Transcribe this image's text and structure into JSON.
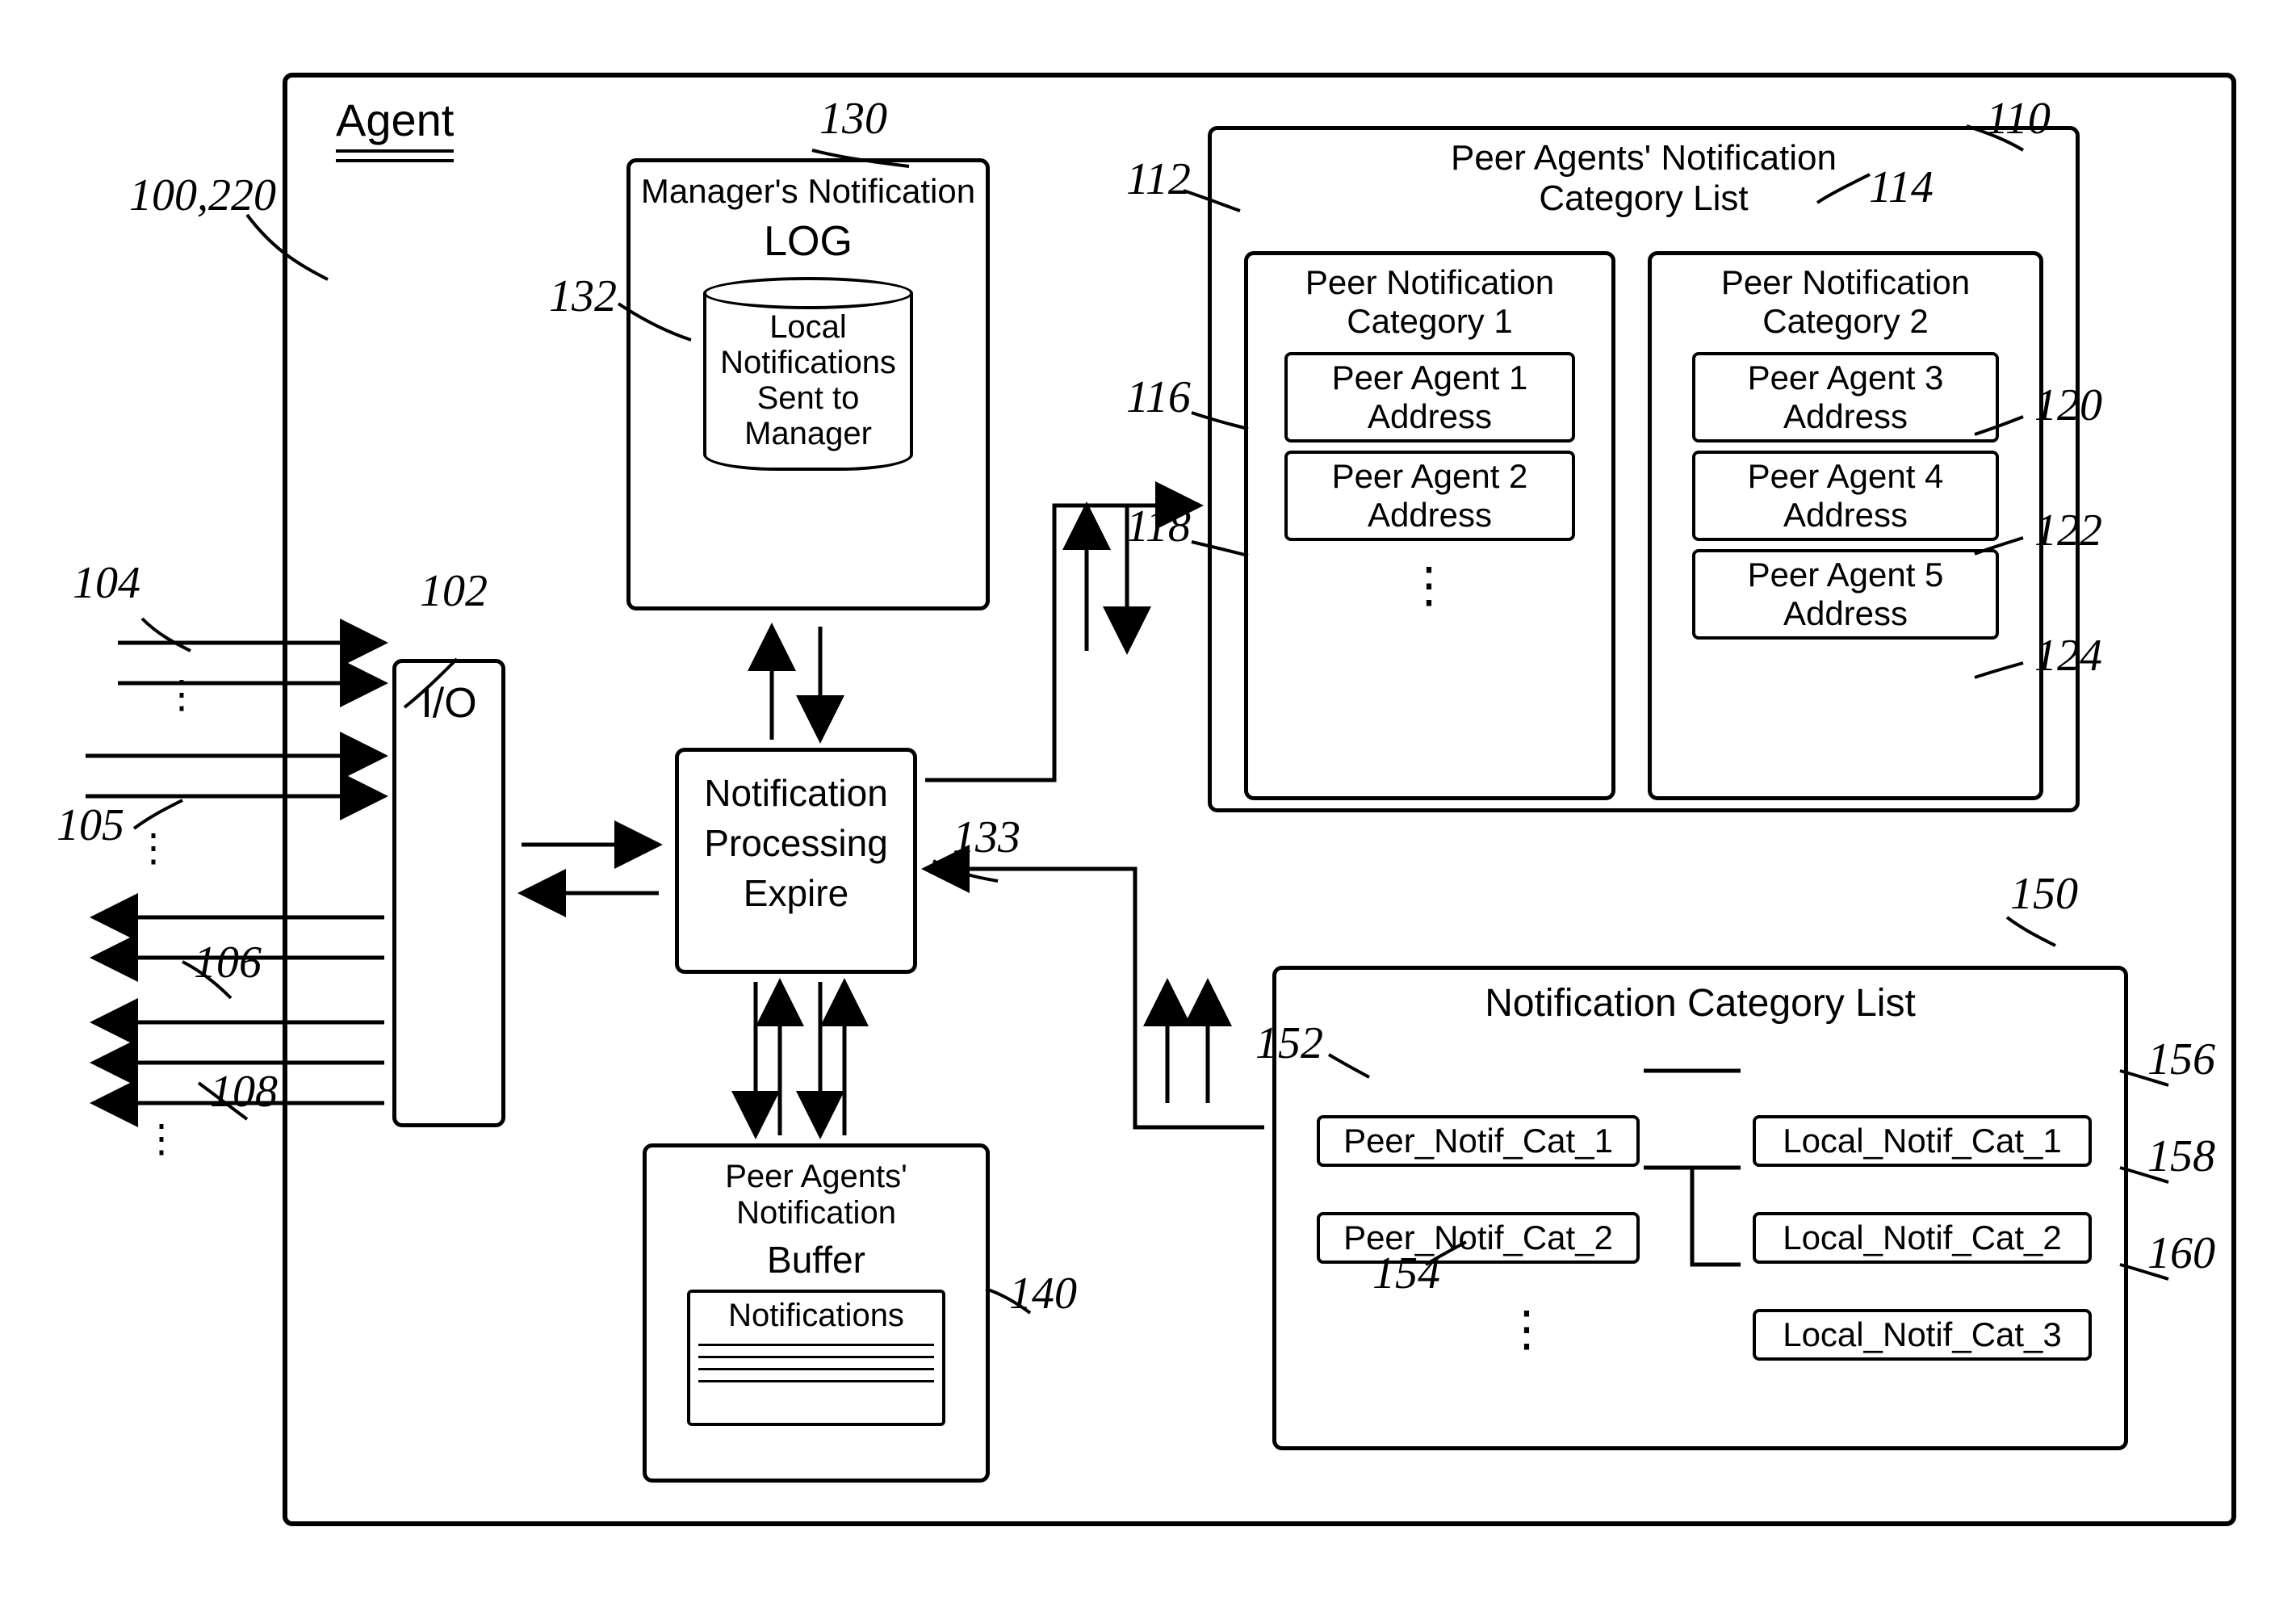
{
  "agent": {
    "title": "Agent"
  },
  "io": {
    "label": "I/O"
  },
  "managersLog": {
    "title1": "Manager's Notification",
    "title2": "LOG",
    "cylinder": "Local\nNotifications\nSent to\nManager"
  },
  "npe": {
    "line1": "Notification",
    "line2": "Processing",
    "line3": "Expire"
  },
  "buffer": {
    "title1": "Peer Agents' Notification",
    "title2": "Buffer",
    "notif": "Notifications"
  },
  "peerCatList": {
    "title": "Peer Agents' Notification\nCategory List",
    "cat1": {
      "title": "Peer Notification\nCategory 1",
      "a1": "Peer Agent 1\nAddress",
      "a2": "Peer Agent 2\nAddress"
    },
    "cat2": {
      "title": "Peer Notification\nCategory 2",
      "a3": "Peer Agent 3\nAddress",
      "a4": "Peer Agent 4\nAddress",
      "a5": "Peer Agent 5\nAddress"
    }
  },
  "notifCatList": {
    "title": "Notification Category List",
    "pn1": "Peer_Notif_Cat_1",
    "pn2": "Peer_Notif_Cat_2",
    "ln1": "Local_Notif_Cat_1",
    "ln2": "Local_Notif_Cat_2",
    "ln3": "Local_Notif_Cat_3"
  },
  "refs": {
    "r100_220": "100,220",
    "r102": "102",
    "r104": "104",
    "r105": "105",
    "r106": "106",
    "r108": "108",
    "r110": "110",
    "r112": "112",
    "r114": "114",
    "r116": "116",
    "r118": "118",
    "r120": "120",
    "r122": "122",
    "r124": "124",
    "r130": "130",
    "r132": "132",
    "r133": "133",
    "r140": "140",
    "r150": "150",
    "r152": "152",
    "r154": "154",
    "r156": "156",
    "r158": "158",
    "r160": "160"
  }
}
